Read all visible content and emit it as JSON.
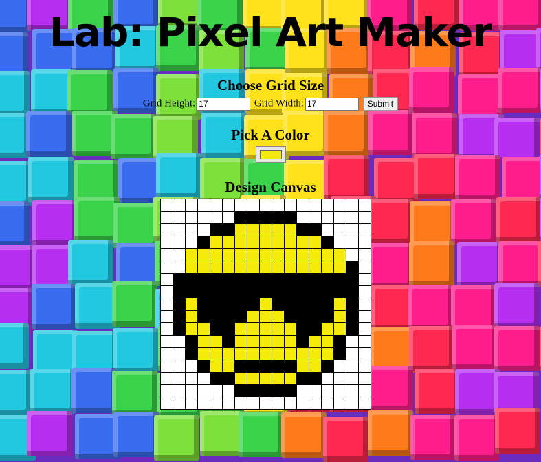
{
  "page": {
    "title": "Lab: Pixel Art Maker",
    "background_colors": [
      "#ff1e8c",
      "#3a6cf0",
      "#22c8e0",
      "#3bd34a",
      "#ffe21a",
      "#ff7a1a",
      "#b62ff0",
      "#ff2850"
    ]
  },
  "size_section": {
    "heading": "Choose Grid Size",
    "height_label": "Grid Height:",
    "height_value": "17",
    "width_label": "Grid Width:",
    "width_value": "17",
    "submit_label": "Submit"
  },
  "color_section": {
    "heading": "Pick A Color",
    "selected_color": "#f5eb0a"
  },
  "canvas_section": {
    "heading": "Design Canvas",
    "rows": 17,
    "cols": 17,
    "palette": {
      "W": "#ffffff",
      "B": "#000000",
      "Y": "#f5eb0a"
    },
    "pixels": [
      "WWWWWWWWWWWWWWWWW",
      "WWWWWWBBBBBWWWWWW",
      "WWWWBBYYYYYBBWWWW",
      "WWWBYYYYYYYYYBWWW",
      "WWYYYYYYYYYYYYYWW",
      "WWYYYYYYYYYYYYYBW",
      "WBBBBBBBBBBBBBBBW",
      "WBBBBBBBBBBBBBBBW",
      "WBYBBBBBYBBBBBYBW",
      "WBYBBBBYYYBBBBYBW",
      "WBYYBBYYYYYBBYYBW",
      "WWBYYBYYYYYBYYBWW",
      "WWBYYYYYYYYYYYBWW",
      "WWWBYYBBBBBYYBWWW",
      "WWWWBBYYYYYBBWWWW",
      "WWWWWWBBBBBWWWWWW",
      "WWWWWWWWWWWWWWWWW"
    ]
  }
}
